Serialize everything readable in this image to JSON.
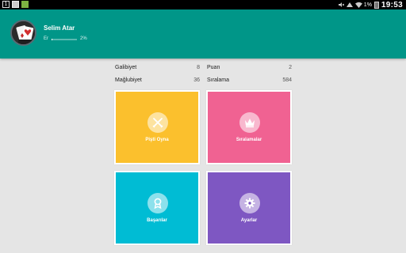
{
  "status_bar": {
    "left_icons": [
      "notification-1-icon",
      "image-icon",
      "document-icon"
    ],
    "notification_count": "1",
    "battery_percent": "1%",
    "time": "19:53"
  },
  "header": {
    "username": "Selim Atar",
    "level_label": "Er",
    "progress_percent": "2%",
    "progress_value": 0.02,
    "color": "#009688"
  },
  "stats": {
    "wins_label": "Galibiyet",
    "wins_value": "8",
    "losses_label": "Mağlubiyet",
    "losses_value": "36",
    "points_label": "Puan",
    "points_value": "2",
    "rank_label": "Sıralama",
    "rank_value": "584"
  },
  "tiles": [
    {
      "label": "Pişti Oyna",
      "icon": "crossed-swords-icon",
      "color": "#fbc02d"
    },
    {
      "label": "Sıralamalar",
      "icon": "crown-icon",
      "color": "#f06292"
    },
    {
      "label": "Başarılar",
      "icon": "medal-icon",
      "color": "#00bcd4"
    },
    {
      "label": "Ayarlar",
      "icon": "gear-icon",
      "color": "#7e57c2"
    }
  ]
}
